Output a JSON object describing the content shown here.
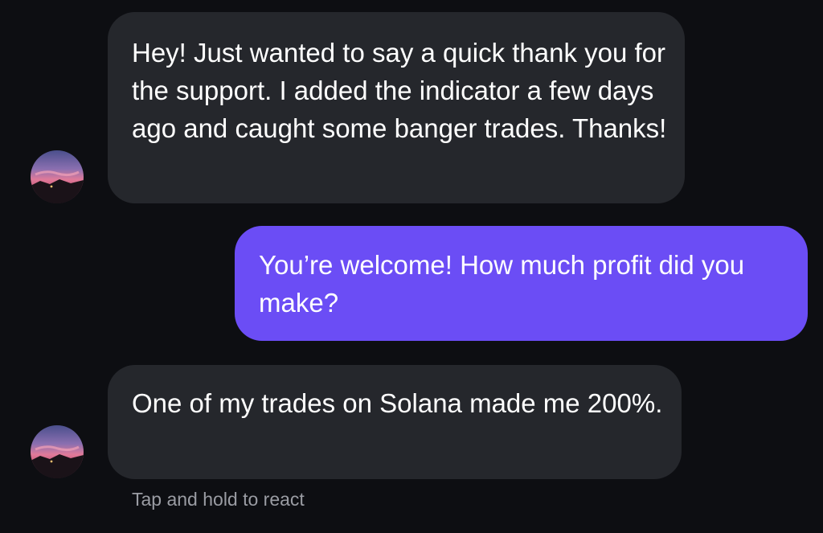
{
  "conversation": {
    "messages": [
      {
        "sender": "them",
        "text": "Hey! Just wanted to say a quick thank you for the support. I added the indicator a few days ago and caught some banger trades. Thanks!"
      },
      {
        "sender": "me",
        "text": "You’re welcome! How much profit did you make?"
      },
      {
        "sender": "them",
        "text": "One of my trades on Solana made me 200%."
      }
    ],
    "reaction_hint": "Tap and hold to react"
  },
  "colors": {
    "background": "#0d0e12",
    "incoming_bubble": "#25272c",
    "outgoing_bubble": "#6b4df5",
    "hint_text": "#9a9ca3"
  }
}
